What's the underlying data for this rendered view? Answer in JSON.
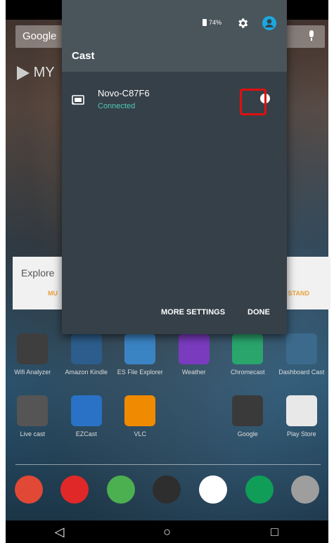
{
  "status": {
    "battery": "74%"
  },
  "home": {
    "search_logo": "Google",
    "play_text": "MY",
    "explore_title": "Explore",
    "explore_left": "MU",
    "explore_right": "STAND",
    "row1": [
      {
        "label": "Wifi Analyzer",
        "icon": "wifi-analyzer-icon",
        "color": "#3e3e3e"
      },
      {
        "label": "Amazon Kindle",
        "icon": "kindle-icon",
        "color": "#2c5d8c"
      },
      {
        "label": "ES File Explorer",
        "icon": "es-file-explorer-icon",
        "color": "#3b84c4"
      },
      {
        "label": "Weather",
        "icon": "weather-icon",
        "color": "#7a3bbf"
      },
      {
        "label": "Chromecast",
        "icon": "chromecast-icon",
        "color": "#2aa56c"
      },
      {
        "label": "Dashboard Cast",
        "icon": "dashboard-cast-icon",
        "color": "#3c6a8c"
      }
    ],
    "row2": [
      {
        "label": "Live cast",
        "icon": "live-cast-icon",
        "color": "#555555"
      },
      {
        "label": "EZCast",
        "icon": "ezcast-icon",
        "color": "#2a72c6"
      },
      {
        "label": "VLC",
        "icon": "vlc-icon",
        "color": "#f08a00"
      },
      {
        "label": "",
        "icon": "blank-icon",
        "color": "transparent"
      },
      {
        "label": "Google",
        "icon": "google-folder-icon",
        "color": "#3a3a3a"
      },
      {
        "label": "Play Store",
        "icon": "play-store-icon",
        "color": "#e8e8e8"
      }
    ],
    "dock": [
      {
        "icon": "chrome-icon",
        "color": "#e14836"
      },
      {
        "icon": "youtube-icon",
        "color": "#e02828"
      },
      {
        "icon": "maps-icon",
        "color": "#4caf50"
      },
      {
        "icon": "app-drawer-icon",
        "color": "#2e2e2e"
      },
      {
        "icon": "gmail-icon",
        "color": "#ffffff"
      },
      {
        "icon": "hangouts-icon",
        "color": "#0f9d58"
      },
      {
        "icon": "camera-icon",
        "color": "#9e9e9e"
      }
    ]
  },
  "cast_panel": {
    "title": "Cast",
    "device_name": "Novo-C87F6",
    "device_status": "Connected",
    "more_settings": "MORE SETTINGS",
    "done": "DONE"
  },
  "nav": {
    "back": "◁",
    "home": "○",
    "recents": "□"
  }
}
